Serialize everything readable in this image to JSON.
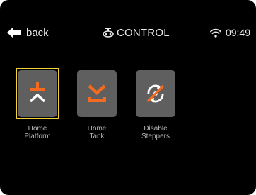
{
  "header": {
    "back_label": "back",
    "title": "CONTROL",
    "time": "09:49"
  },
  "tiles": [
    {
      "label_line1": "Home",
      "label_line2": "Platform",
      "icon": "home-platform-icon",
      "selected": true
    },
    {
      "label_line1": "Home",
      "label_line2": "Tank",
      "icon": "home-tank-icon",
      "selected": false
    },
    {
      "label_line1": "Disable",
      "label_line2": "Steppers",
      "icon": "disable-steppers-icon",
      "selected": false
    }
  ],
  "colors": {
    "background": "#000000",
    "tile": "#5f5f5f",
    "accent": "#f26b21",
    "selection": "#f2d33c",
    "text": "#e8e8e8",
    "label": "#b8b8b8"
  }
}
